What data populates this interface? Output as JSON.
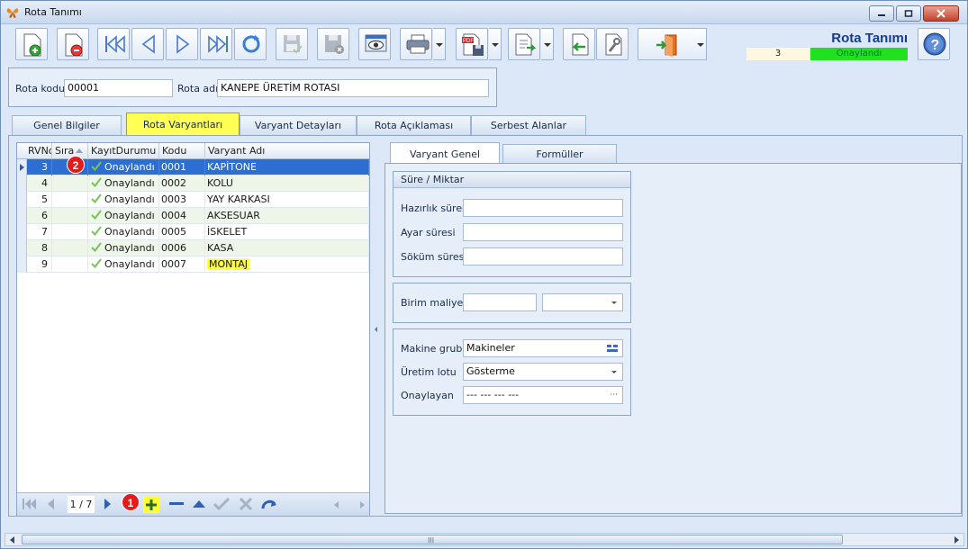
{
  "window": {
    "title": "Rota Tanımı"
  },
  "header": {
    "form_title": "Rota Tanımı",
    "record_no": "3",
    "record_status": "Onaylandı",
    "status_color": "#20e020"
  },
  "toolbar": {
    "icons": [
      "new-document-icon",
      "delete-document-icon",
      "first-record-icon",
      "previous-record-icon",
      "next-record-icon",
      "last-record-icon",
      "refresh-icon",
      "save-icon",
      "save-cancel-icon",
      "preview-icon",
      "print-icon",
      "pdf-export-icon",
      "export-icon",
      "import-icon",
      "settings-icon",
      "exit-icon",
      "help-icon"
    ]
  },
  "route": {
    "code_label": "Rota kodu",
    "code_value": "00001",
    "name_label": "Rota adı",
    "name_value": "KANEPE ÜRETİM ROTASI"
  },
  "tabs": [
    {
      "label": "Genel Bilgiler",
      "active": false
    },
    {
      "label": "Rota Varyantları",
      "active": true
    },
    {
      "label": "Varyant Detayları",
      "active": false
    },
    {
      "label": "Rota Açıklaması",
      "active": false
    },
    {
      "label": "Serbest Alanlar",
      "active": false
    }
  ],
  "grid": {
    "columns": [
      "RVNo",
      "Sıra",
      "KayıtDurumu",
      "Kodu",
      "Varyant Adı"
    ],
    "rows": [
      {
        "rv": "3",
        "sira": "",
        "durum": "Onaylandı",
        "kod": "0001",
        "ad": "KAPİTONE",
        "selected": true
      },
      {
        "rv": "4",
        "sira": "",
        "durum": "Onaylandı",
        "kod": "0002",
        "ad": "KOLU"
      },
      {
        "rv": "5",
        "sira": "",
        "durum": "Onaylandı",
        "kod": "0003",
        "ad": "YAY KARKASI"
      },
      {
        "rv": "6",
        "sira": "",
        "durum": "Onaylandı",
        "kod": "0004",
        "ad": "AKSESUAR"
      },
      {
        "rv": "7",
        "sira": "",
        "durum": "Onaylandı",
        "kod": "0005",
        "ad": "İSKELET"
      },
      {
        "rv": "8",
        "sira": "",
        "durum": "Onaylandı",
        "kod": "0006",
        "ad": "KASA"
      },
      {
        "rv": "9",
        "sira": "",
        "durum": "Onaylandı",
        "kod": "0007",
        "ad": "MONTAJ",
        "highlight": true
      }
    ],
    "navigator_count": "1 / 7"
  },
  "badges": {
    "one": "1",
    "two": "2"
  },
  "subtabs": [
    {
      "label": "Varyant Genel Bilgileri",
      "active": true
    },
    {
      "label": "Formüller",
      "active": false
    }
  ],
  "details": {
    "group_duration": "Süre / Miktar",
    "prep_label": "Hazırlık süresi",
    "prep_value": "",
    "setup_label": "Ayar süresi",
    "setup_value": "",
    "teardown_label": "Söküm süresi",
    "teardown_value": "",
    "unit_cost_label": "Birim maliyet",
    "unit_cost_value": "",
    "unit_cost_currency": "",
    "machine_group_label": "Makine grubu",
    "machine_group_value": "Makineler",
    "production_lot_label": "Üretim lotu",
    "production_lot_value": "Gösterme",
    "approver_label": "Onaylayan",
    "approver_value": "--- --- --- ---"
  },
  "scrollbar": {
    "grip": "III"
  }
}
